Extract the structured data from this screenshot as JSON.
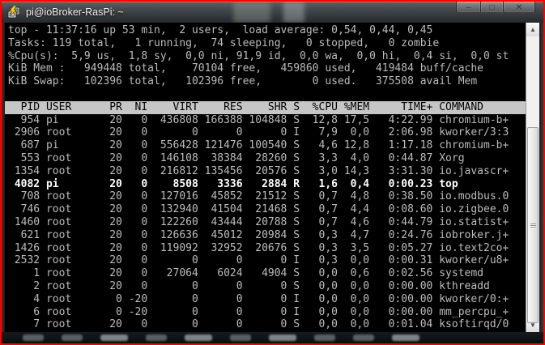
{
  "window": {
    "title": "pi@ioBroker-RasPi: ~",
    "controls": {
      "minimize": "–",
      "maximize": "□",
      "close": "✕"
    },
    "scrollbar": {
      "up_glyph": "▲",
      "down_glyph": "▼"
    }
  },
  "terminal": {
    "summary_lines": [
      "top - 11:37:16 up 53 min,  2 users,  load average: 0,54, 0,44, 0,45",
      "Tasks: 119 total,   1 running,  74 sleeping,   0 stopped,   0 zombie",
      "%Cpu(s):  5,9 us,  1,8 sy,  0,0 ni, 91,9 id,  0,0 wa,  0,0 hi,  0,4 si,  0,0 st",
      "KiB Mem :   949448 total,    70104 free,   459860 used,   419484 buff/cache",
      "KiB Swap:   102396 total,   102396 free,        0 used.   375508 avail Mem"
    ],
    "columns": [
      "PID",
      "USER",
      "PR",
      "NI",
      "VIRT",
      "RES",
      "SHR",
      "S",
      "%CPU",
      "%MEM",
      "TIME+",
      "COMMAND"
    ],
    "rows": [
      {
        "pid": "954",
        "user": "pi",
        "pr": "20",
        "ni": "0",
        "virt": "436808",
        "res": "166388",
        "shr": "104848",
        "s": "S",
        "cpu": "12,8",
        "mem": "17,5",
        "time": "4:22.99",
        "command": "chromium-b+",
        "bold": false
      },
      {
        "pid": "2906",
        "user": "root",
        "pr": "20",
        "ni": "0",
        "virt": "0",
        "res": "0",
        "shr": "0",
        "s": "I",
        "cpu": "7,9",
        "mem": "0,0",
        "time": "2:06.98",
        "command": "kworker/3:3",
        "bold": false
      },
      {
        "pid": "687",
        "user": "pi",
        "pr": "20",
        "ni": "0",
        "virt": "556428",
        "res": "121476",
        "shr": "100540",
        "s": "S",
        "cpu": "4,6",
        "mem": "12,8",
        "time": "1:17.18",
        "command": "chromium-b+",
        "bold": false
      },
      {
        "pid": "553",
        "user": "root",
        "pr": "20",
        "ni": "0",
        "virt": "146108",
        "res": "38384",
        "shr": "28260",
        "s": "S",
        "cpu": "3,3",
        "mem": "4,0",
        "time": "0:44.87",
        "command": "Xorg",
        "bold": false
      },
      {
        "pid": "1354",
        "user": "root",
        "pr": "20",
        "ni": "0",
        "virt": "216812",
        "res": "135456",
        "shr": "20576",
        "s": "S",
        "cpu": "3,0",
        "mem": "14,3",
        "time": "3:31.30",
        "command": "io.javascr+",
        "bold": false
      },
      {
        "pid": "4082",
        "user": "pi",
        "pr": "20",
        "ni": "0",
        "virt": "8508",
        "res": "3336",
        "shr": "2884",
        "s": "R",
        "cpu": "1,6",
        "mem": "0,4",
        "time": "0:00.23",
        "command": "top",
        "bold": true
      },
      {
        "pid": "708",
        "user": "root",
        "pr": "20",
        "ni": "0",
        "virt": "127016",
        "res": "45852",
        "shr": "21512",
        "s": "S",
        "cpu": "0,7",
        "mem": "4,8",
        "time": "0:38.50",
        "command": "io.modbus.0",
        "bold": false
      },
      {
        "pid": "746",
        "user": "root",
        "pr": "20",
        "ni": "0",
        "virt": "132940",
        "res": "41504",
        "shr": "21468",
        "s": "S",
        "cpu": "0,7",
        "mem": "4,4",
        "time": "0:08.60",
        "command": "io.zigbee.0",
        "bold": false
      },
      {
        "pid": "1460",
        "user": "root",
        "pr": "20",
        "ni": "0",
        "virt": "122260",
        "res": "43444",
        "shr": "20788",
        "s": "S",
        "cpu": "0,7",
        "mem": "4,6",
        "time": "0:44.79",
        "command": "io.statist+",
        "bold": false
      },
      {
        "pid": "621",
        "user": "root",
        "pr": "20",
        "ni": "0",
        "virt": "126636",
        "res": "45012",
        "shr": "20984",
        "s": "S",
        "cpu": "0,3",
        "mem": "4,7",
        "time": "0:24.76",
        "command": "iobroker.j+",
        "bold": false
      },
      {
        "pid": "1426",
        "user": "root",
        "pr": "20",
        "ni": "0",
        "virt": "119092",
        "res": "32952",
        "shr": "20676",
        "s": "S",
        "cpu": "0,3",
        "mem": "3,5",
        "time": "0:05.27",
        "command": "io.text2co+",
        "bold": false
      },
      {
        "pid": "2532",
        "user": "root",
        "pr": "20",
        "ni": "0",
        "virt": "0",
        "res": "0",
        "shr": "0",
        "s": "I",
        "cpu": "0,3",
        "mem": "0,0",
        "time": "0:00.31",
        "command": "kworker/u8+",
        "bold": false
      },
      {
        "pid": "1",
        "user": "root",
        "pr": "20",
        "ni": "0",
        "virt": "27064",
        "res": "6024",
        "shr": "4904",
        "s": "S",
        "cpu": "0,0",
        "mem": "0,6",
        "time": "0:02.56",
        "command": "systemd",
        "bold": false
      },
      {
        "pid": "2",
        "user": "root",
        "pr": "20",
        "ni": "0",
        "virt": "0",
        "res": "0",
        "shr": "0",
        "s": "S",
        "cpu": "0,0",
        "mem": "0,0",
        "time": "0:00.00",
        "command": "kthreadd",
        "bold": false
      },
      {
        "pid": "4",
        "user": "root",
        "pr": "0",
        "ni": "-20",
        "virt": "0",
        "res": "0",
        "shr": "0",
        "s": "I",
        "cpu": "0,0",
        "mem": "0,0",
        "time": "0:00.00",
        "command": "kworker/0:+",
        "bold": false
      },
      {
        "pid": "6",
        "user": "root",
        "pr": "0",
        "ni": "-20",
        "virt": "0",
        "res": "0",
        "shr": "0",
        "s": "I",
        "cpu": "0,0",
        "mem": "0,0",
        "time": "0:00.00",
        "command": "mm_percpu_+",
        "bold": false
      },
      {
        "pid": "7",
        "user": "root",
        "pr": "20",
        "ni": "0",
        "virt": "0",
        "res": "0",
        "shr": "0",
        "s": "S",
        "cpu": "0,0",
        "mem": "0,0",
        "time": "0:01.04",
        "command": "ksoftirqd/0",
        "bold": false
      }
    ]
  },
  "colors": {
    "terminal_bg": "#000000",
    "terminal_text": "#bcbcbc",
    "header_bg": "#c6c6c6",
    "highlight_text": "#ffffff",
    "annotation_border": "#ff0000"
  }
}
